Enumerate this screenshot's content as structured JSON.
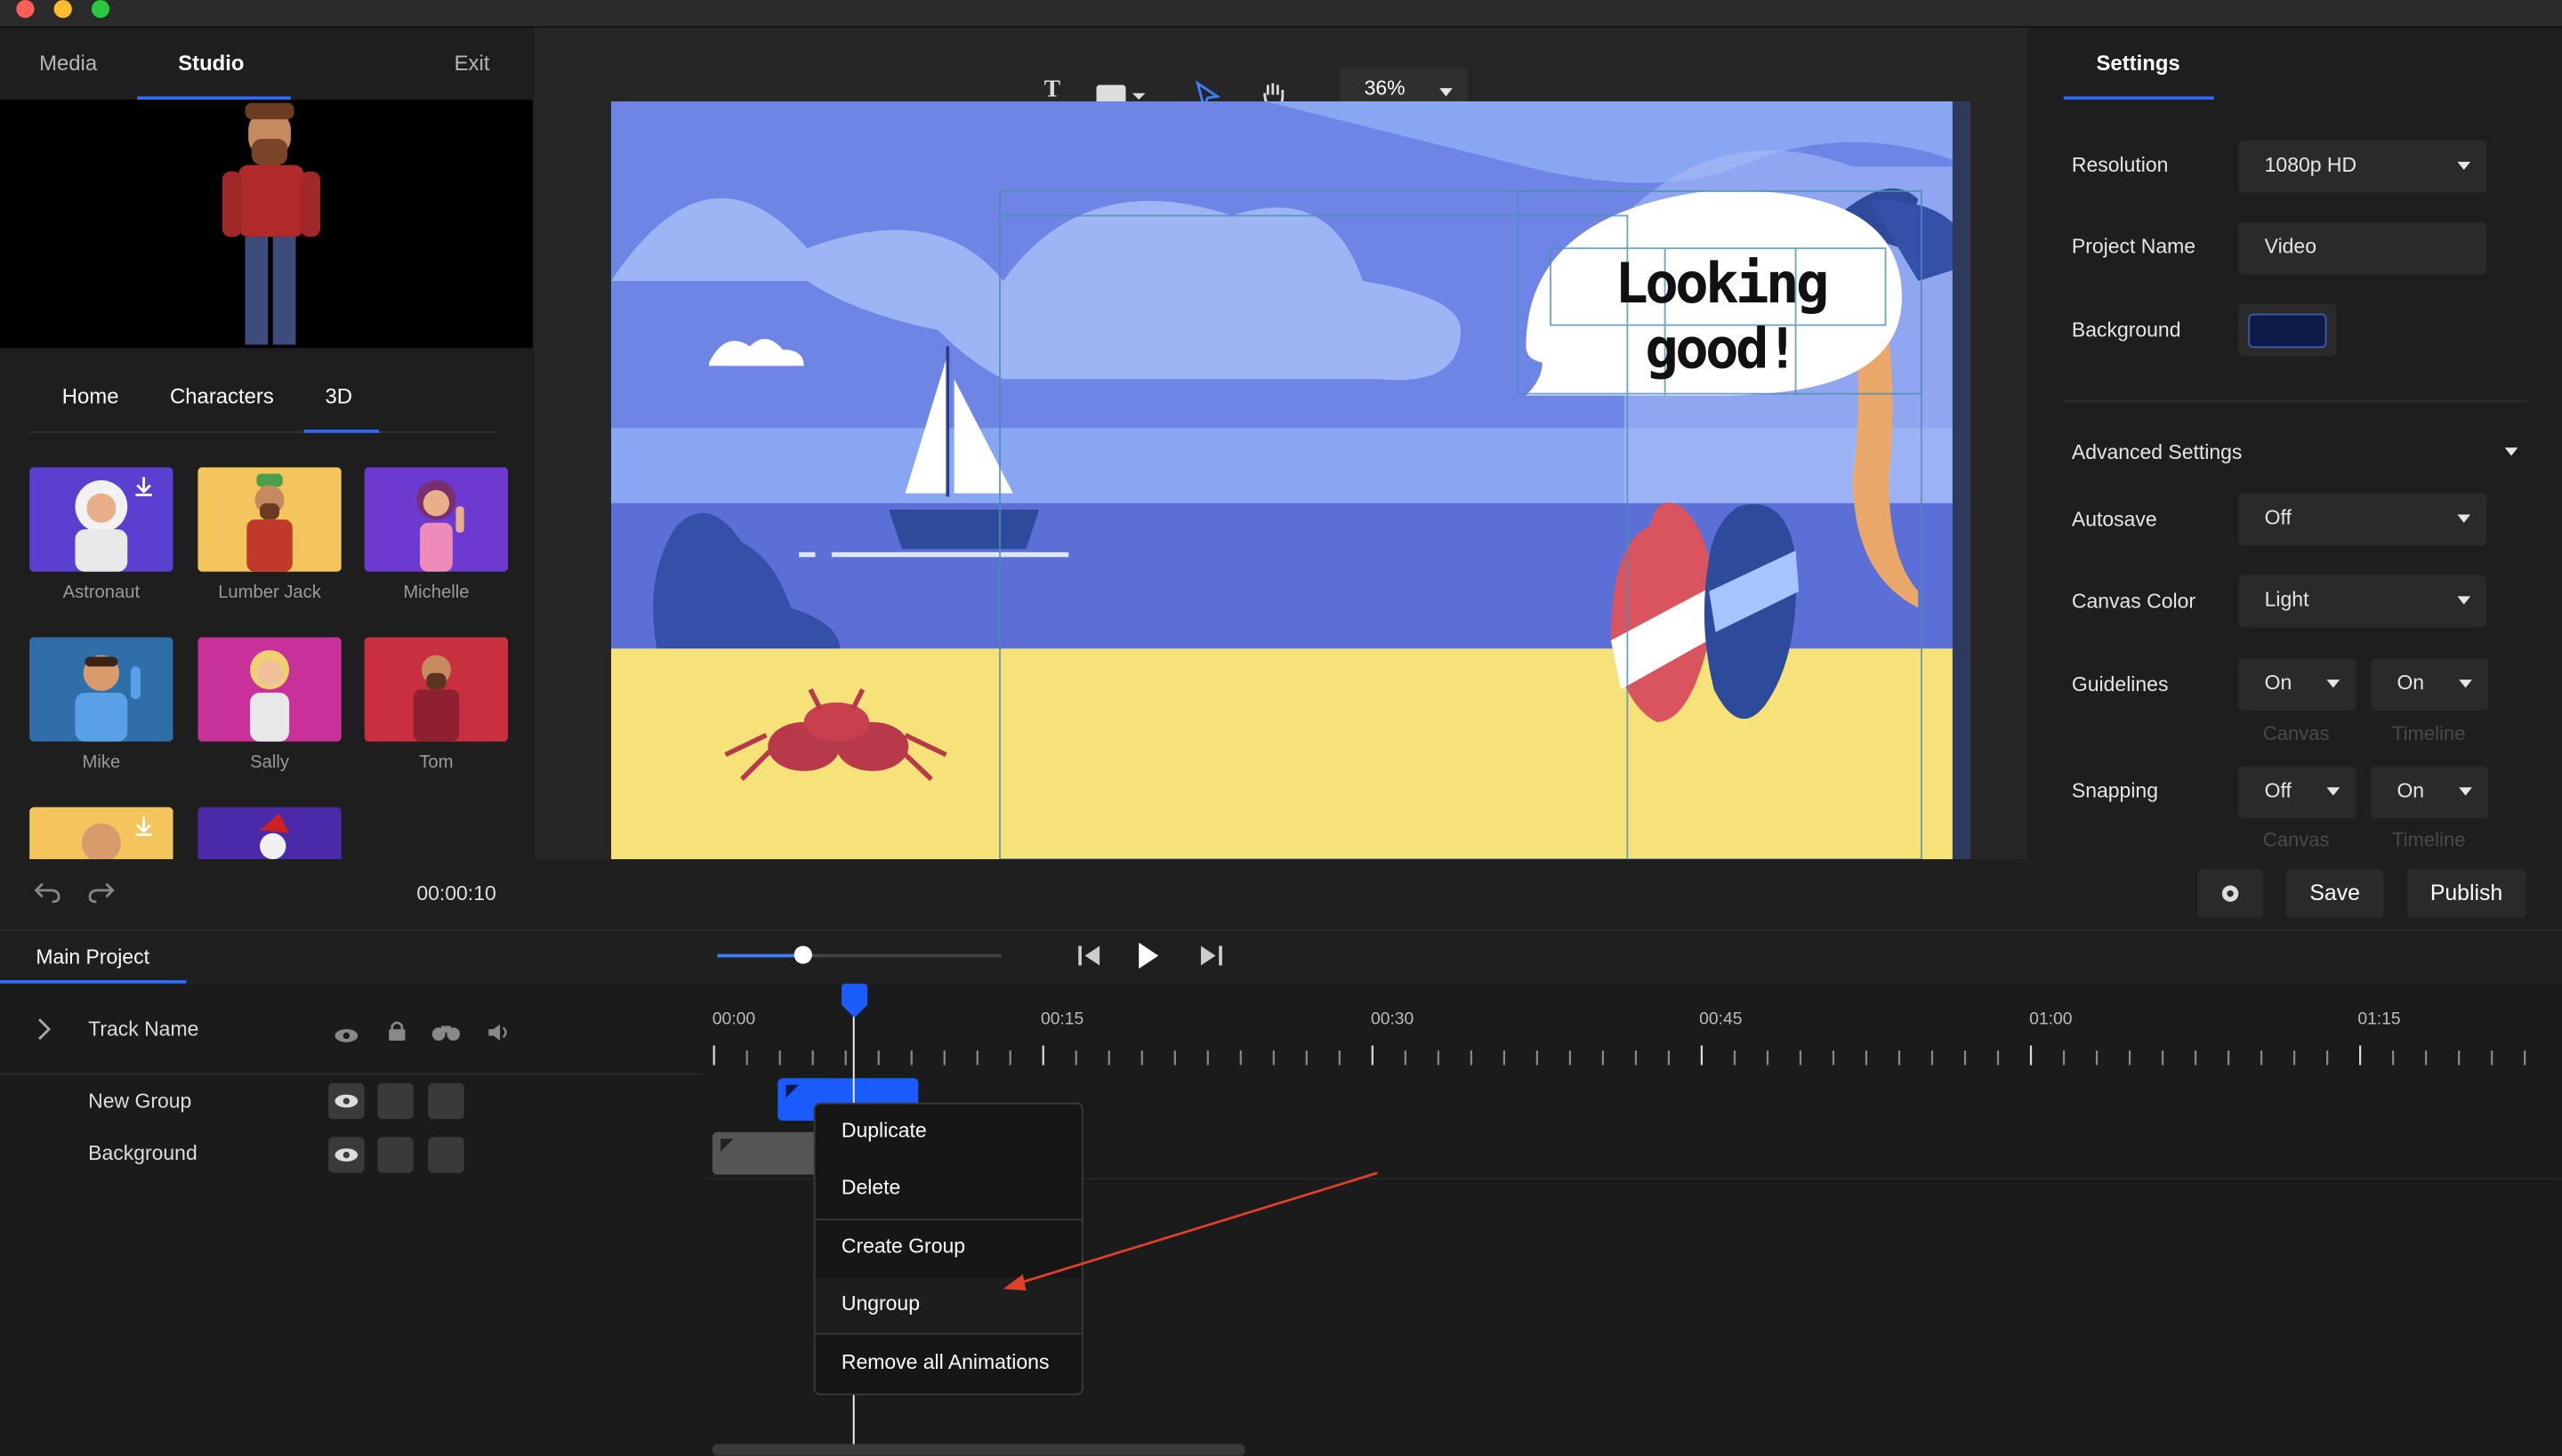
{
  "top_tabs": {
    "media": "Media",
    "studio": "Studio",
    "exit": "Exit"
  },
  "sub_tabs": {
    "home": "Home",
    "characters": "Characters",
    "tab3d": "3D"
  },
  "characters": [
    {
      "name": "Astronaut",
      "bg": "#5a3fd0"
    },
    {
      "name": "Lumber Jack",
      "bg": "#f4c55c"
    },
    {
      "name": "Michelle",
      "bg": "#6c3ad0"
    },
    {
      "name": "Mike",
      "bg": "#2f6ea8"
    },
    {
      "name": "Sally",
      "bg": "#c8309a"
    },
    {
      "name": "Tom",
      "bg": "#c8303f"
    }
  ],
  "left_controls": {
    "time": "00:00:10"
  },
  "toolbar": {
    "zoom": "36%"
  },
  "canvas": {
    "speech_text": "Looking good!"
  },
  "settings": {
    "tab": "Settings",
    "resolution_label": "Resolution",
    "resolution_value": "1080p HD",
    "project_name_label": "Project Name",
    "project_name_value": "Video",
    "background_label": "Background",
    "background_color": "#0e1a4a",
    "advanced_title": "Advanced Settings",
    "autosave_label": "Autosave",
    "autosave_value": "Off",
    "canvas_color_label": "Canvas Color",
    "canvas_color_value": "Light",
    "guidelines_label": "Guidelines",
    "guidelines_canvas": "On",
    "guidelines_timeline": "On",
    "snapping_label": "Snapping",
    "snapping_canvas": "Off",
    "snapping_timeline": "On",
    "sub_canvas": "Canvas",
    "sub_timeline": "Timeline"
  },
  "actions": {
    "save": "Save",
    "publish": "Publish"
  },
  "timeline": {
    "project_tab": "Main Project",
    "track_name_header": "Track Name",
    "tracks": [
      "New Group",
      "Background"
    ],
    "ticks": [
      "00:00",
      "00:15",
      "00:30",
      "00:45",
      "01:00",
      "01:15"
    ],
    "progress": 0.3
  },
  "context_menu": [
    "Duplicate",
    "Delete",
    "Create Group",
    "Ungroup",
    "Remove all Animations"
  ],
  "colors": {
    "accent": "#2f6bff",
    "annotation_arrow": "#e0402a"
  }
}
